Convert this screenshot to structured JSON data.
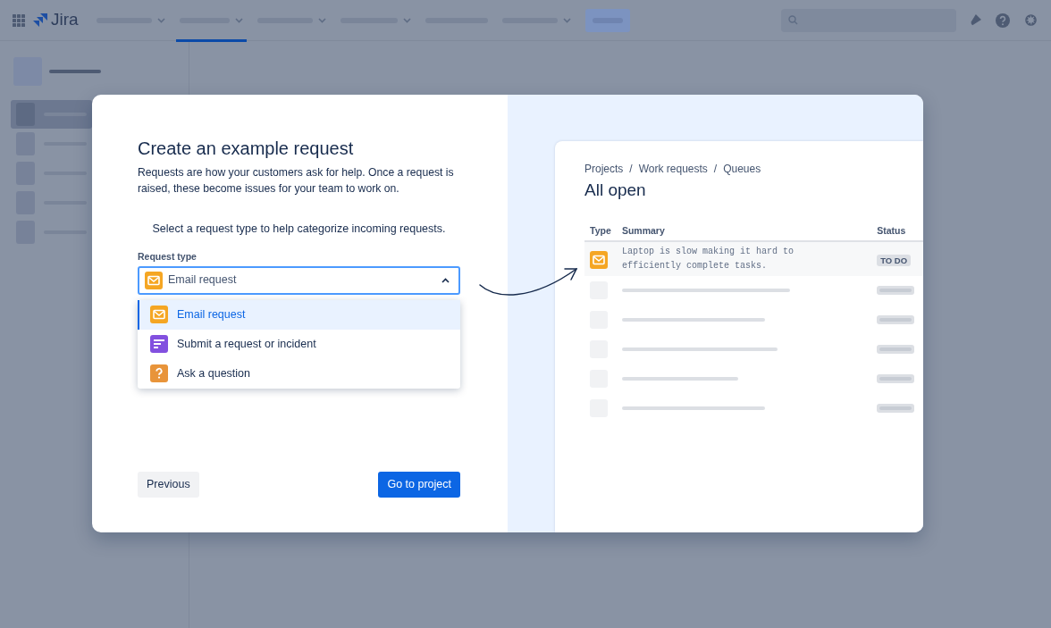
{
  "app": {
    "logo": "Jira",
    "nav_items": [
      {
        "selected": false
      },
      {
        "selected": true
      },
      {
        "selected": false
      },
      {
        "selected": false
      },
      {
        "selected": false
      },
      {
        "selected": false
      }
    ]
  },
  "sidebar": {
    "items": [
      {
        "selected": true
      },
      {
        "selected": false
      },
      {
        "selected": false
      },
      {
        "selected": false
      },
      {
        "selected": false
      }
    ]
  },
  "modal": {
    "title": "Create an example request",
    "description": "Requests are how your customers ask for help. Once a request is raised, these become issues for your team to work on.",
    "prompt": "Select a request type to help categorize incoming requests.",
    "field_label": "Request type",
    "select": {
      "kind": "email",
      "value": "Email request",
      "expanded": true
    },
    "options": [
      {
        "kind": "email",
        "label": "Email request",
        "selected": true
      },
      {
        "kind": "form",
        "label": "Submit a request or incident",
        "selected": false
      },
      {
        "kind": "question",
        "label": "Ask a question",
        "selected": false
      }
    ],
    "buttons": [
      {
        "kind": "secondary",
        "label": "Previous"
      },
      {
        "kind": "primary",
        "label": "Go to project"
      }
    ]
  },
  "preview": {
    "breadcrumbs": [
      "Projects",
      "Work requests",
      "Queues"
    ],
    "breadcrumb_separator": "/",
    "title": "All open",
    "columns": [
      "Type",
      "Summary",
      "Status"
    ],
    "rows": [
      {
        "kind": "email",
        "summary": "Laptop is slow making it hard to efficiently complete tasks.",
        "status": "TO DO",
        "selected": true
      }
    ]
  }
}
